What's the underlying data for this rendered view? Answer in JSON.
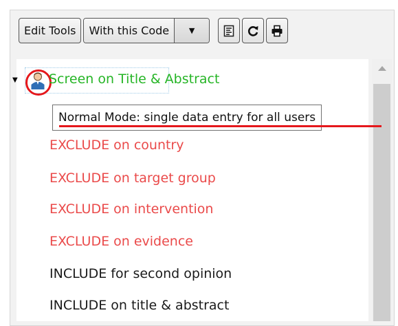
{
  "toolbar": {
    "edit_tools_label": "Edit Tools",
    "with_code_label": "With this Code",
    "dropdown_arrow": "▼",
    "icons": [
      "report-icon",
      "refresh-icon",
      "print-icon"
    ]
  },
  "tree": {
    "root": {
      "expand_glyph": "▼",
      "icon": "user-icon",
      "label": "Screen on Title & Abstract",
      "color": "#26b526"
    },
    "tooltip": "Normal Mode: single data entry for all users",
    "children": [
      {
        "label": "EXCLUDE on country",
        "color": "#ea4a4a"
      },
      {
        "label": "EXCLUDE on target group",
        "color": "#ea4a4a"
      },
      {
        "label": "EXCLUDE on intervention",
        "color": "#ea4a4a"
      },
      {
        "label": "EXCLUDE on evidence",
        "color": "#ea4a4a"
      },
      {
        "label": "INCLUDE for second opinion",
        "color": "#1a1a1a"
      },
      {
        "label": "INCLUDE on title & abstract",
        "color": "#1a1a1a"
      }
    ]
  },
  "annotation": {
    "highlight_color": "#e5171b"
  }
}
